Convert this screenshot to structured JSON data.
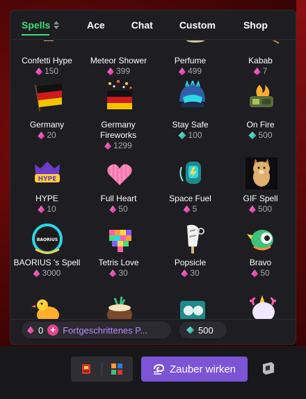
{
  "tabs": [
    {
      "label": "Spells",
      "active": true
    },
    {
      "label": "Ace"
    },
    {
      "label": "Chat"
    },
    {
      "label": "Custom"
    },
    {
      "label": "Shop"
    }
  ],
  "spells": [
    {
      "name": "Confetti Hype",
      "price": "150",
      "currency": "bits"
    },
    {
      "name": "Meteor Shower",
      "price": "399",
      "currency": "bits"
    },
    {
      "name": "Perfume",
      "price": "499",
      "currency": "bits"
    },
    {
      "name": "Kabab",
      "price": "7",
      "currency": "bits"
    },
    {
      "name": "Germany",
      "price": "20",
      "currency": "bits"
    },
    {
      "name": "Germany Fireworks",
      "price": "1299",
      "currency": "bits"
    },
    {
      "name": "Stay Safe",
      "price": "100",
      "currency": "gems"
    },
    {
      "name": "On Fire",
      "price": "500",
      "currency": "gems"
    },
    {
      "name": "HYPE",
      "price": "10",
      "currency": "bits"
    },
    {
      "name": "Full Heart",
      "price": "50",
      "currency": "bits"
    },
    {
      "name": "Space Fuel",
      "price": "5",
      "currency": "bits"
    },
    {
      "name": "GIF Spell",
      "price": "500",
      "currency": "bits"
    },
    {
      "name": "BAORIUS 's Spell",
      "price": "3000",
      "currency": "bits"
    },
    {
      "name": "Tetris Love",
      "price": "30",
      "currency": "bits"
    },
    {
      "name": "Popsicle",
      "price": "30",
      "currency": "bits"
    },
    {
      "name": "Bravo",
      "price": "50",
      "currency": "bits"
    }
  ],
  "art_labels": {
    "hype": "HYPE",
    "baorius": "BAORIUS"
  },
  "wallet": {
    "bits": "0",
    "upgrade_label": "Fortgeschrittenes P...",
    "gems": "500"
  },
  "chat": {
    "cast_button_label": "Zauber wirken"
  },
  "colors": {
    "accent_green": "#3ee07a",
    "cast_purple": "#7b55d6",
    "upgrade_purple": "#b889ff",
    "bits_pink": "#e0468f",
    "gem_teal": "#19a89a"
  }
}
